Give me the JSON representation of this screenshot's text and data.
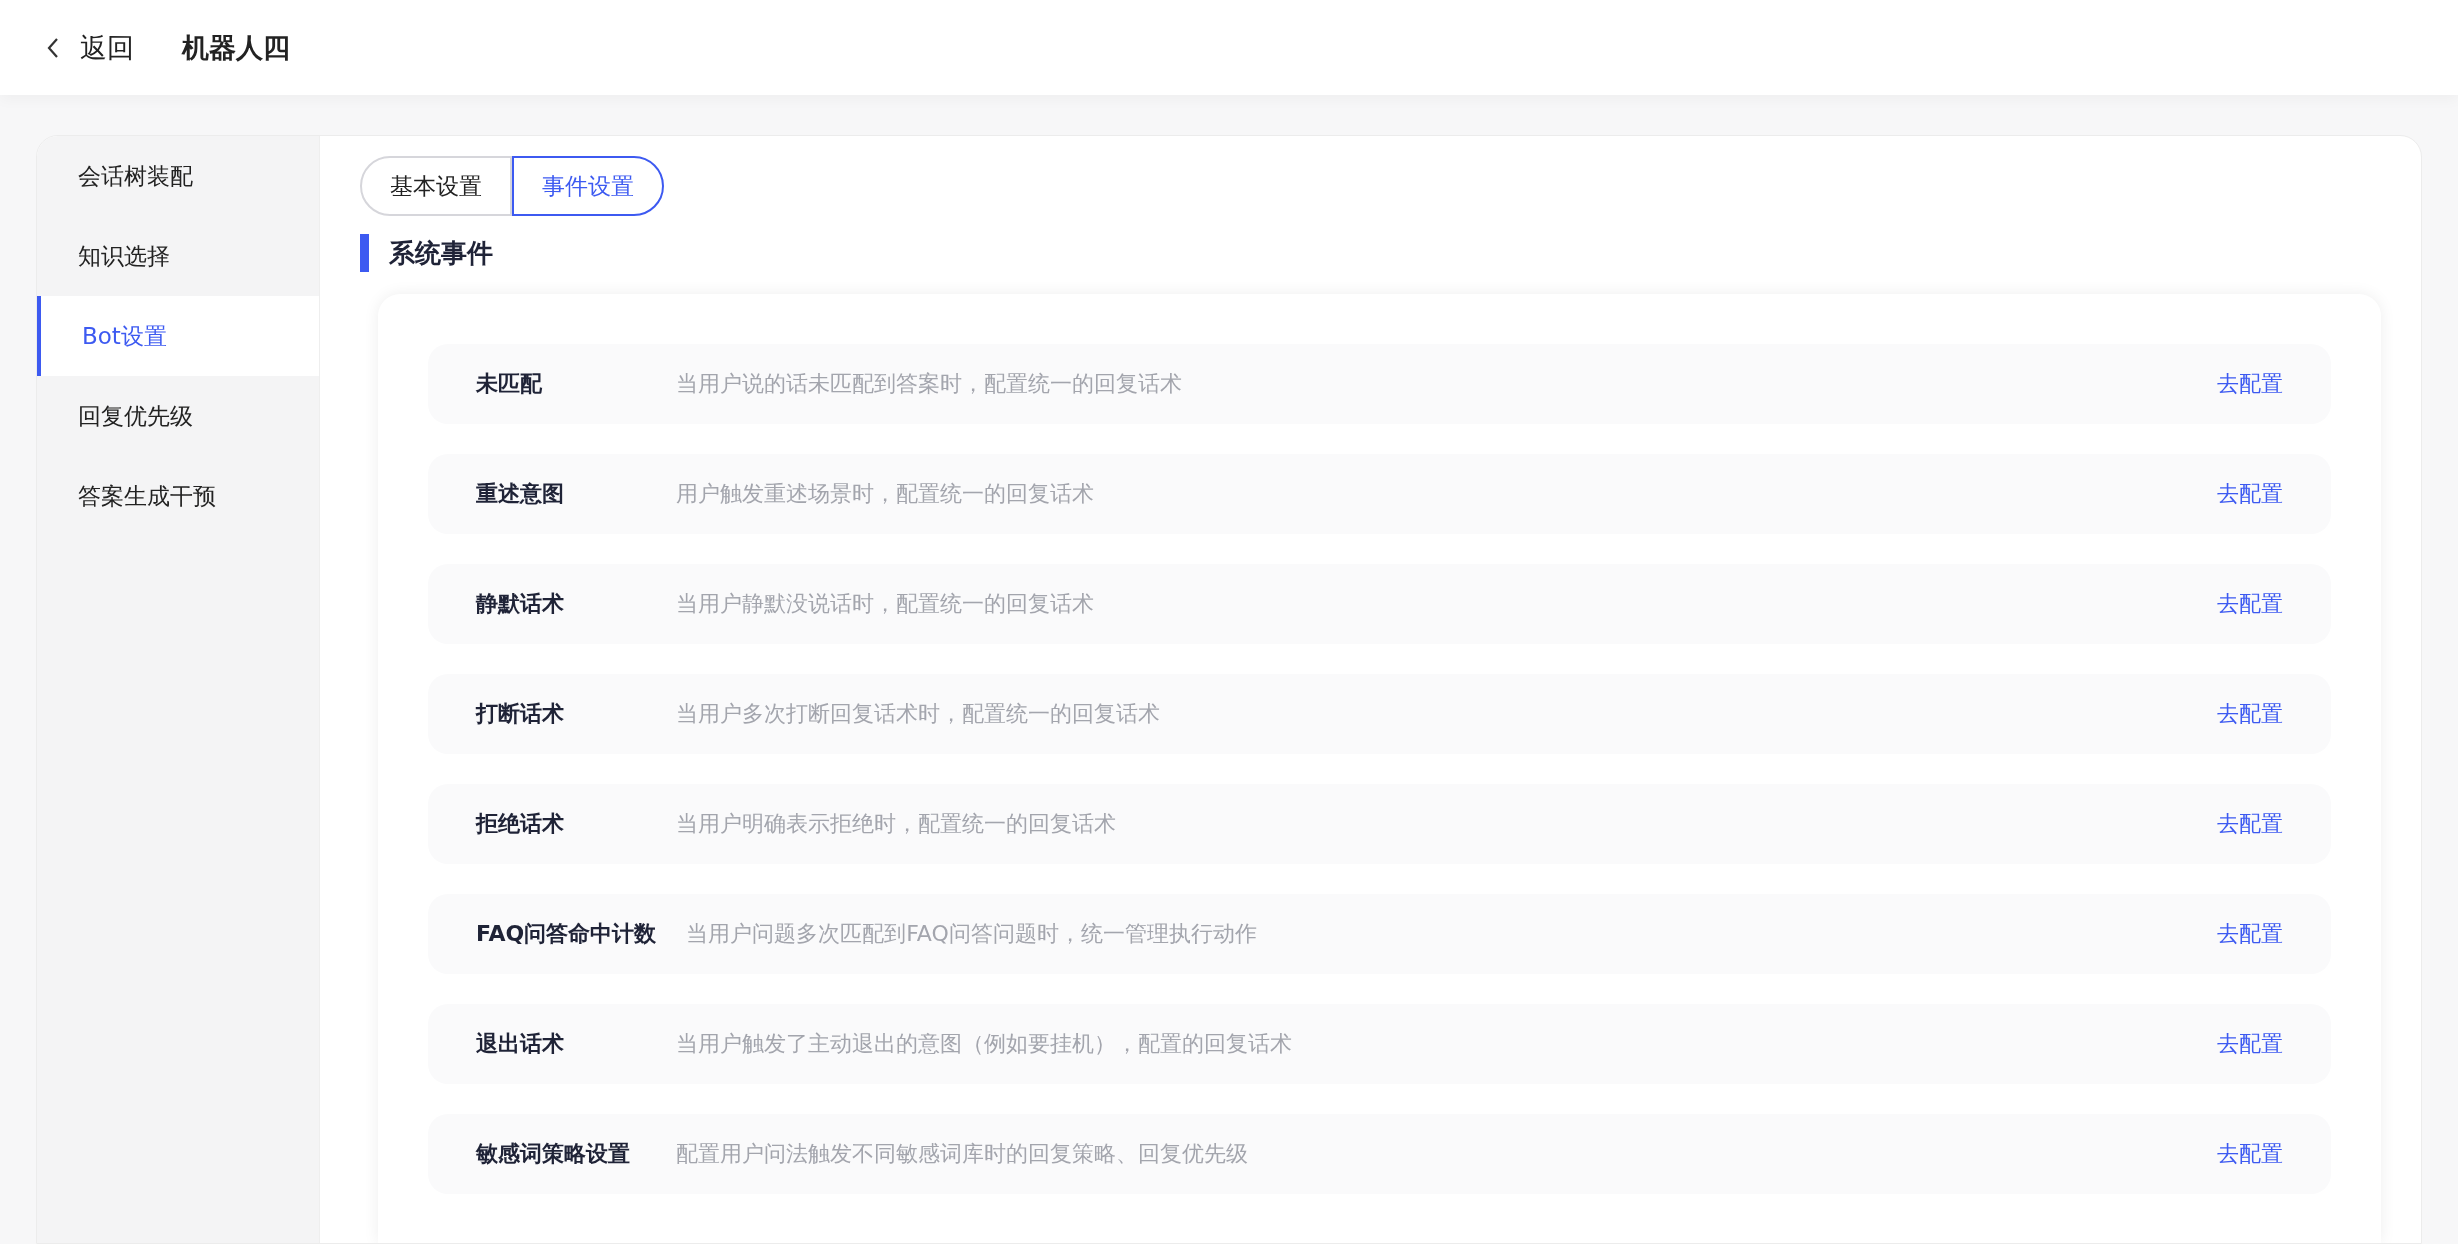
{
  "header": {
    "back_label": "返回",
    "title": "机器人四"
  },
  "sidebar": {
    "items": [
      {
        "label": "会话树装配",
        "selected": false
      },
      {
        "label": "知识选择",
        "selected": false
      },
      {
        "label": "Bot设置",
        "selected": true
      },
      {
        "label": "回复优先级",
        "selected": false
      },
      {
        "label": "答案生成干预",
        "selected": false
      }
    ]
  },
  "tabs": [
    {
      "label": "基本设置",
      "selected": false
    },
    {
      "label": "事件设置",
      "selected": true
    }
  ],
  "section_title": "系统事件",
  "events": [
    {
      "name": "未匹配",
      "description": "当用户说的话未匹配到答案时，配置统一的回复话术",
      "action": "去配置"
    },
    {
      "name": "重述意图",
      "description": "用户触发重述场景时，配置统一的回复话术",
      "action": "去配置"
    },
    {
      "name": "静默话术",
      "description": "当用户静默没说话时，配置统一的回复话术",
      "action": "去配置"
    },
    {
      "name": "打断话术",
      "description": "当用户多次打断回复话术时，配置统一的回复话术",
      "action": "去配置"
    },
    {
      "name": "拒绝话术",
      "description": "当用户明确表示拒绝时，配置统一的回复话术",
      "action": "去配置"
    },
    {
      "name": "FAQ问答命中计数",
      "description": "当用户问题多次匹配到FAQ问答问题时，统一管理执行动作",
      "action": "去配置"
    },
    {
      "name": "退出话术",
      "description": "当用户触发了主动退出的意图（例如要挂机），配置的回复话术",
      "action": "去配置"
    },
    {
      "name": "敏感词策略设置",
      "description": "配置用户问法触发不同敏感词库时的回复策略、回复优先级",
      "action": "去配置"
    }
  ]
}
